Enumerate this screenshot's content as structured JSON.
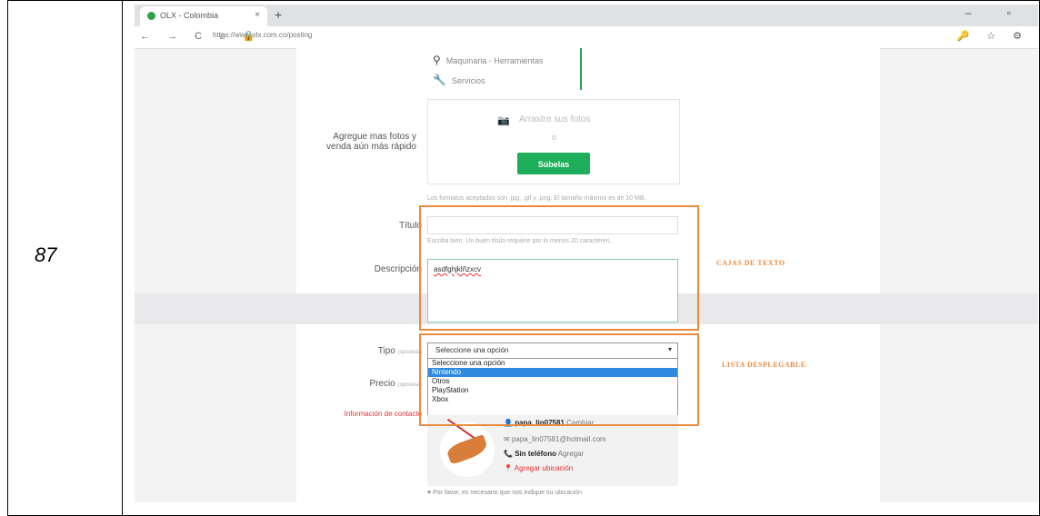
{
  "row_number": "87",
  "browser": {
    "tab_title": "OLX - Colombia",
    "tab_close": "×",
    "new_tab": "+",
    "url": "https://www.olx.com.co/posting",
    "window_controls": "– ▫",
    "nav": "← → C ⌂ 🔒",
    "right_icons": "🔑 ☆ ⚙"
  },
  "menu": {
    "items": [
      {
        "icon": "binoculars-icon",
        "label": "Maquinaria - Herramientas"
      },
      {
        "icon": "wrench-icon",
        "label": "Servicios"
      }
    ]
  },
  "photos": {
    "label": "Agregue mas fotos y venda aún más rápido",
    "drop_text": "Arrastre sus fotos",
    "or_text": "o",
    "button": "Súbelas",
    "hint": "Los formatos aceptados son .jpg, .gif y .png. El tamaño máximo es de 10 MB."
  },
  "title_field": {
    "label": "Título",
    "hint": "Escriba bien. Un buen título requiere por lo menos 20 caracteres."
  },
  "description_field": {
    "label": "Descripción",
    "value": "asdfghjklñzxcv"
  },
  "type_field": {
    "label": "Tipo",
    "label_suffix": "(opcional)",
    "selected": "Seleccione una opción",
    "options": [
      "Seleccione una opción",
      "Nintendo",
      "Otros",
      "PlayStation",
      "Xbox"
    ],
    "highlighted_index": 1
  },
  "price_field": {
    "label": "Precio",
    "label_suffix": "(opcional)"
  },
  "contact": {
    "label": "Información de contacto",
    "username": "papa_lin07581",
    "username_action": "Cambiar",
    "email": "papa_lin07581@hotmail.com",
    "phone": "Sin teléfono",
    "phone_action": "Agregar",
    "location": "Agregar ubicación",
    "note": "Por favor, es necesario que nos indique su ubicación"
  },
  "annotations": {
    "text_boxes": "CAJAS DE TEXTO",
    "dropdown": "LISTA DESPLEGABLE",
    "color": "#ec8a3c"
  }
}
